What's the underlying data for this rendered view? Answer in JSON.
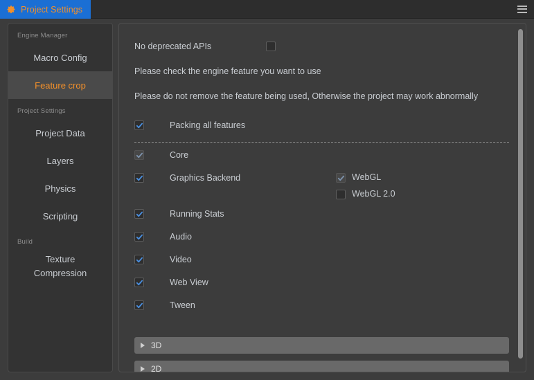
{
  "titlebar": {
    "tab_label": "Project Settings",
    "gear_icon": "gear-icon",
    "menu_icon": "hamburger-menu-icon",
    "tab_color": "#1b6fd4",
    "accent_color": "#f3902a"
  },
  "sidebar": {
    "groups": [
      {
        "label": "Engine Manager",
        "items": [
          {
            "label": "Macro Config",
            "selected": false
          },
          {
            "label": "Feature crop",
            "selected": true
          }
        ]
      },
      {
        "label": "Project Settings",
        "items": [
          {
            "label": "Project Data",
            "selected": false
          },
          {
            "label": "Layers",
            "selected": false
          },
          {
            "label": "Physics",
            "selected": false
          },
          {
            "label": "Scripting",
            "selected": false
          }
        ]
      },
      {
        "label": "Build",
        "items": [
          {
            "label_line1": "Texture",
            "label_line2": "Compression",
            "selected": false
          }
        ]
      }
    ]
  },
  "main": {
    "deprecated": {
      "label": "No deprecated APIs",
      "checked": false
    },
    "notes": [
      "Please check the engine feature you want to use",
      "Please do not remove the feature being used, Otherwise the project may work abnormally"
    ],
    "packing": {
      "label": "Packing all features",
      "checked": true,
      "disabled": false
    },
    "features": [
      {
        "label": "Core",
        "checked": true,
        "disabled": true
      },
      {
        "label": "Graphics Backend",
        "checked": true,
        "disabled": false,
        "sub": [
          {
            "label": "WebGL",
            "checked": true,
            "disabled": true
          },
          {
            "label": "WebGL 2.0",
            "checked": false,
            "disabled": false
          }
        ]
      },
      {
        "label": "Running Stats",
        "checked": true,
        "disabled": false
      },
      {
        "label": "Audio",
        "checked": true,
        "disabled": false
      },
      {
        "label": "Video",
        "checked": true,
        "disabled": false
      },
      {
        "label": "Web View",
        "checked": true,
        "disabled": false
      },
      {
        "label": "Tween",
        "checked": true,
        "disabled": false
      }
    ],
    "accordions": [
      {
        "label": "3D",
        "expanded": false
      },
      {
        "label": "2D",
        "expanded": false
      }
    ]
  }
}
